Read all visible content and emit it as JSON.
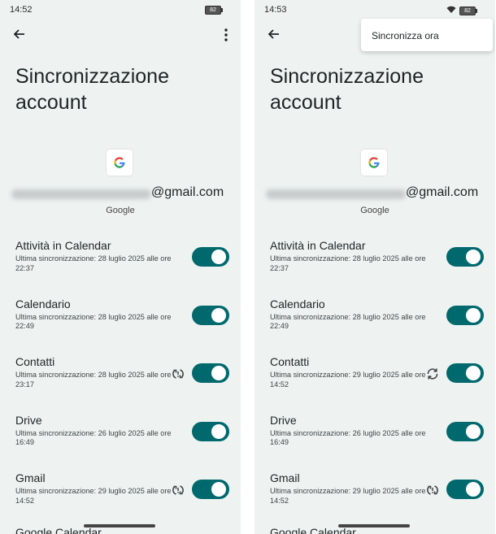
{
  "screens": [
    {
      "status": {
        "time": "14:52",
        "battery": "82",
        "wifi": false
      },
      "title": "Sincronizzazione account",
      "email_domain": "@gmail.com",
      "provider": "Google",
      "show_menu_icon": true,
      "menu_popup": null,
      "items": [
        {
          "label": "Attività in Calendar",
          "subtitle": "Ultima sincronizzazione: 28 luglio 2025 alle ore 22:37",
          "icon": null,
          "enabled": true
        },
        {
          "label": "Calendario",
          "subtitle": "Ultima sincronizzazione: 28 luglio 2025 alle ore 22:49",
          "icon": null,
          "enabled": true
        },
        {
          "label": "Contatti",
          "subtitle": "Ultima sincronizzazione: 28 luglio 2025 alle ore 23:17",
          "icon": "sync-problem-icon",
          "enabled": true
        },
        {
          "label": "Drive",
          "subtitle": "Ultima sincronizzazione: 26 luglio 2025 alle ore 16:49",
          "icon": null,
          "enabled": true
        },
        {
          "label": "Gmail",
          "subtitle": "Ultima sincronizzazione: 29 luglio 2025 alle ore 14:52",
          "icon": "sync-problem-icon",
          "enabled": true
        }
      ],
      "partial_item": "Google Calendar"
    },
    {
      "status": {
        "time": "14:53",
        "battery": "82",
        "wifi": true
      },
      "title": "Sincronizzazione account",
      "email_domain": "@gmail.com",
      "provider": "Google",
      "show_menu_icon": false,
      "menu_popup": {
        "label": "Sincronizza ora"
      },
      "items": [
        {
          "label": "Attività in Calendar",
          "subtitle": "Ultima sincronizzazione: 28 luglio 2025 alle ore 22:37",
          "icon": null,
          "enabled": true
        },
        {
          "label": "Calendario",
          "subtitle": "Ultima sincronizzazione: 28 luglio 2025 alle ore 22:49",
          "icon": null,
          "enabled": true
        },
        {
          "label": "Contatti",
          "subtitle": "Ultima sincronizzazione: 29 luglio 2025 alle ore 14:52",
          "icon": "sync-active-icon",
          "enabled": true
        },
        {
          "label": "Drive",
          "subtitle": "Ultima sincronizzazione: 26 luglio 2025 alle ore 16:49",
          "icon": null,
          "enabled": true
        },
        {
          "label": "Gmail",
          "subtitle": "Ultima sincronizzazione: 29 luglio 2025 alle ore 14:52",
          "icon": "sync-problem-icon",
          "enabled": true
        }
      ],
      "partial_item": "Google Calendar"
    }
  ],
  "colors": {
    "background": "#eef3f2",
    "toggle_on": "#00696d",
    "text": "#1d2424"
  }
}
